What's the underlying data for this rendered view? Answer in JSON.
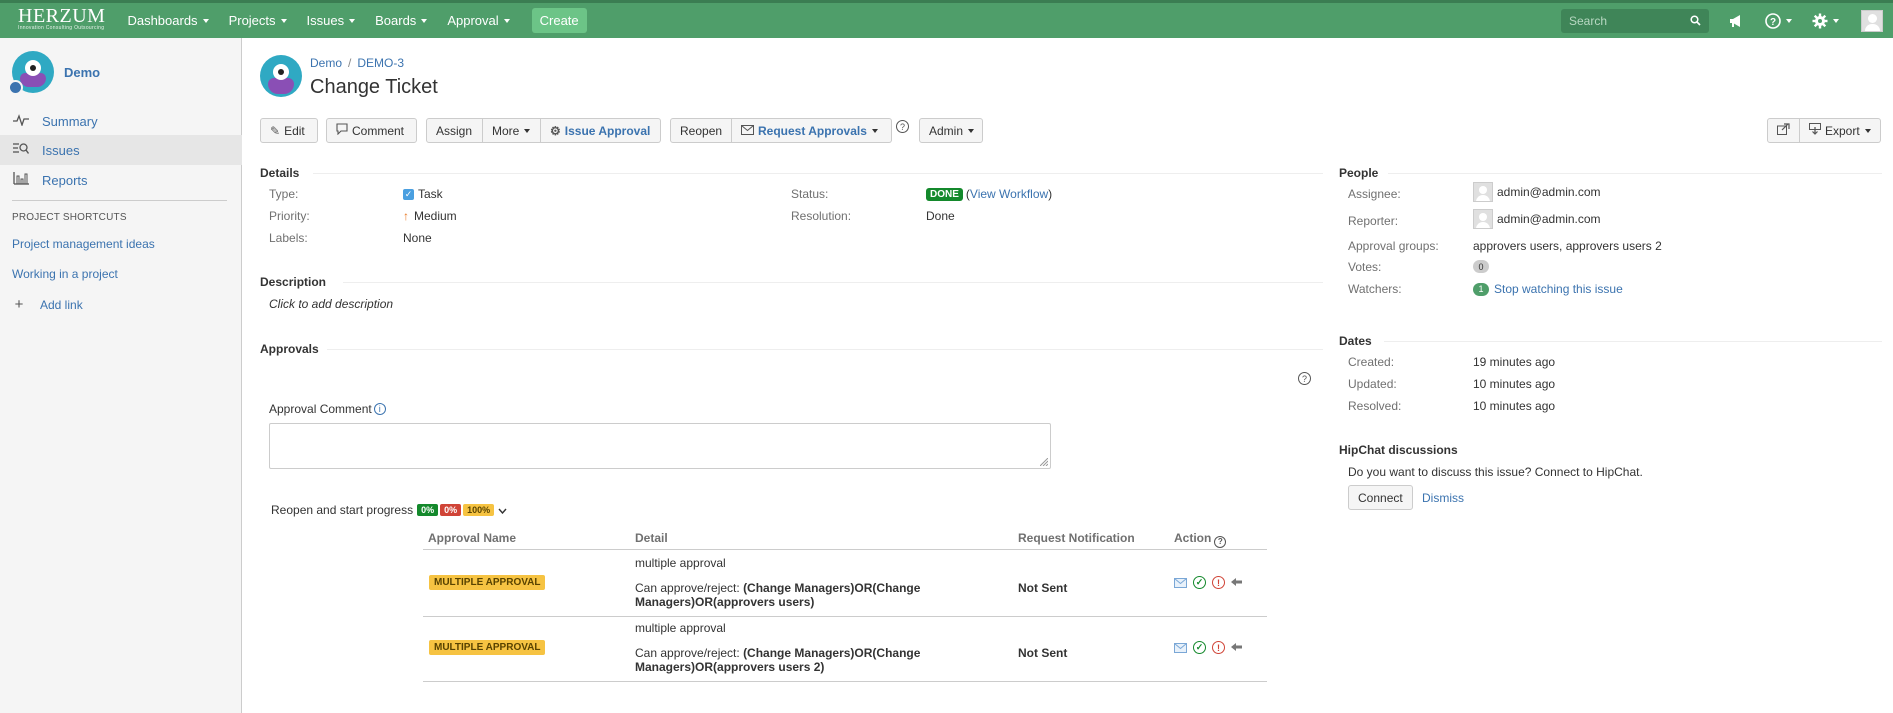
{
  "topnav": {
    "logo": "HERZUM",
    "logo_tagline": "Innovation Consulting Outsourcing",
    "menus": [
      "Dashboards",
      "Projects",
      "Issues",
      "Boards",
      "Approval"
    ],
    "create_label": "Create",
    "search_placeholder": "Search"
  },
  "sidebar": {
    "project_name": "Demo",
    "items": [
      {
        "label": "Summary",
        "icon": "pulse-icon"
      },
      {
        "label": "Issues",
        "icon": "issues-icon"
      },
      {
        "label": "Reports",
        "icon": "reports-icon"
      }
    ],
    "shortcuts_heading": "PROJECT SHORTCUTS",
    "shortcuts": [
      "Project management ideas",
      "Working in a project"
    ],
    "add_link_label": "Add link"
  },
  "issue": {
    "breadcrumb": [
      "Demo",
      "DEMO-3"
    ],
    "title": "Change Ticket"
  },
  "toolbar": {
    "edit": "Edit",
    "comment": "Comment",
    "assign": "Assign",
    "more": "More",
    "issue_approval": "Issue Approval",
    "reopen": "Reopen",
    "request_approvals": "Request Approvals",
    "admin": "Admin",
    "export": "Export"
  },
  "details": {
    "heading": "Details",
    "type_label": "Type:",
    "type_value": "Task",
    "priority_label": "Priority:",
    "priority_value": "Medium",
    "labels_label": "Labels:",
    "labels_value": "None",
    "status_label": "Status:",
    "status_value": "DONE",
    "status_link": "View Workflow",
    "resolution_label": "Resolution:",
    "resolution_value": "Done"
  },
  "description": {
    "heading": "Description",
    "placeholder": "Click to add description"
  },
  "approvals": {
    "heading": "Approvals",
    "comment_label": "Approval Comment",
    "transition": "Reopen and start progress",
    "pct": [
      "0%",
      "0%",
      "100%"
    ],
    "columns": [
      "Approval Name",
      "Detail",
      "Request Notification",
      "Action"
    ],
    "rows": [
      {
        "name": "MULTIPLE APPROVAL",
        "detail_title": "multiple approval",
        "detail_prefix": "Can approve/reject: ",
        "detail_bold_1": "(Change Managers)OR(Change",
        "detail_bold_2": "Managers)OR(approvers users)",
        "notification": "Not Sent"
      },
      {
        "name": "MULTIPLE APPROVAL",
        "detail_title": "multiple approval",
        "detail_prefix": "Can approve/reject: ",
        "detail_bold_1": "(Change Managers)OR(Change",
        "detail_bold_2": "Managers)OR(approvers users 2)",
        "notification": "Not Sent"
      }
    ]
  },
  "people": {
    "heading": "People",
    "assignee_label": "Assignee:",
    "assignee": "admin@admin.com",
    "reporter_label": "Reporter:",
    "reporter": "admin@admin.com",
    "groups_label": "Approval groups:",
    "groups": "approvers users, approvers users 2",
    "votes_label": "Votes:",
    "votes": "0",
    "watchers_label": "Watchers:",
    "watchers": "1",
    "watch_link": "Stop watching this issue"
  },
  "dates": {
    "heading": "Dates",
    "created_label": "Created:",
    "created": "19 minutes ago",
    "updated_label": "Updated:",
    "updated": "10 minutes ago",
    "resolved_label": "Resolved:",
    "resolved": "10 minutes ago"
  },
  "hipchat": {
    "heading": "HipChat discussions",
    "text": "Do you want to discuss this issue? Connect to HipChat.",
    "connect": "Connect",
    "dismiss": "Dismiss"
  },
  "colors": {
    "nav": "#4f9e6a",
    "create": "#6cc487",
    "link": "#3b73af",
    "done": "#14892c",
    "lozenge": "#f6c342"
  }
}
